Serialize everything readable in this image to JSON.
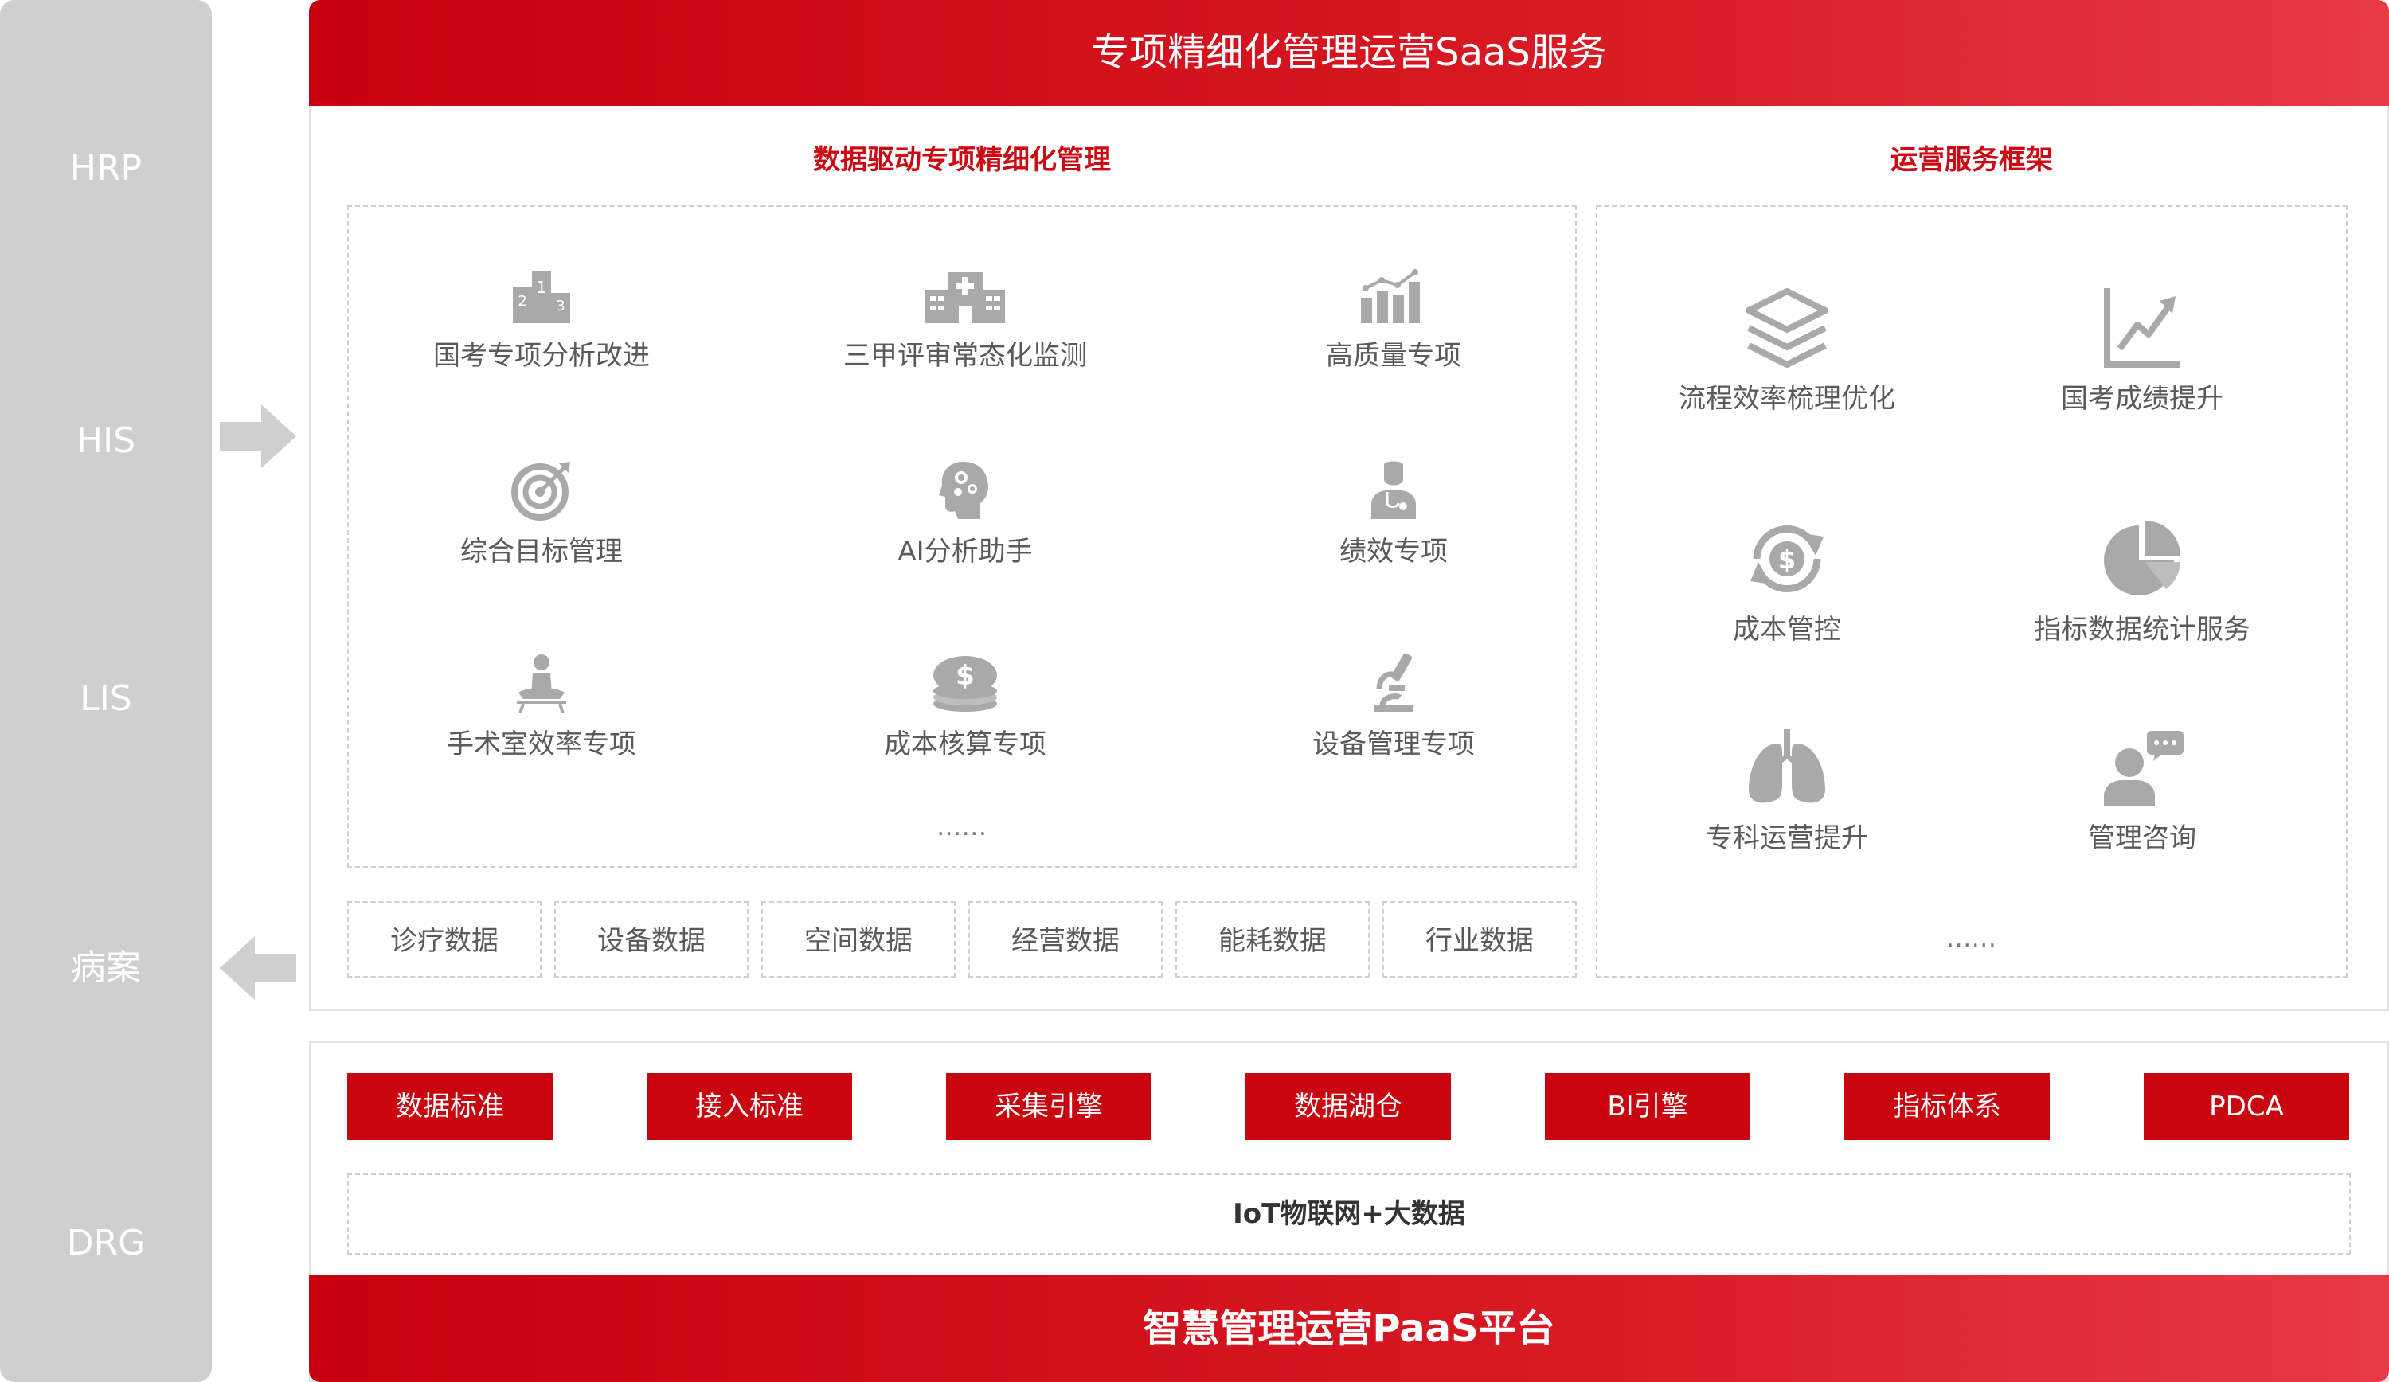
{
  "left_systems": [
    "HRP",
    "HIS",
    "LIS",
    "病案",
    "DRG"
  ],
  "saas": {
    "title": "专项精细化管理运营SaaS服务",
    "left_section": {
      "title": "数据驱动专项精细化管理",
      "features": [
        {
          "icon": "podium-icon",
          "label": "国考专项分析改进"
        },
        {
          "icon": "hospital-icon",
          "label": "三甲评审常态化监测"
        },
        {
          "icon": "bar-chart-icon",
          "label": "高质量专项"
        },
        {
          "icon": "target-icon",
          "label": "综合目标管理"
        },
        {
          "icon": "ai-head-icon",
          "label": "AI分析助手"
        },
        {
          "icon": "doctor-icon",
          "label": "绩效专项"
        },
        {
          "icon": "surgeon-icon",
          "label": "手术室效率专项"
        },
        {
          "icon": "coin-stack-icon",
          "label": "成本核算专项"
        },
        {
          "icon": "microscope-icon",
          "label": "设备管理专项"
        }
      ],
      "ellipsis": "......",
      "data_sources": [
        "诊疗数据",
        "设备数据",
        "空间数据",
        "经营数据",
        "能耗数据",
        "行业数据"
      ]
    },
    "right_section": {
      "title": "运营服务框架",
      "features": [
        {
          "icon": "layers-icon",
          "label": "流程效率梳理优化"
        },
        {
          "icon": "trend-chart-icon",
          "label": "国考成绩提升"
        },
        {
          "icon": "dollar-cycle-icon",
          "label": "成本管控"
        },
        {
          "icon": "pie-chart-icon",
          "label": "指标数据统计服务"
        },
        {
          "icon": "lungs-icon",
          "label": "专科运营提升"
        },
        {
          "icon": "consultant-icon",
          "label": "管理咨询"
        }
      ],
      "ellipsis": "......"
    }
  },
  "paas": {
    "modules": [
      "数据标准",
      "接入标准",
      "采集引擎",
      "数据湖仓",
      "BI引擎",
      "指标体系",
      "PDCA"
    ],
    "foundation": "IoT物联网+大数据",
    "title": "智慧管理运营PaaS平台"
  },
  "colors": {
    "accent": "#c9060f",
    "gray_panel": "#cfcfcf",
    "icon_gray": "#a9a9a9"
  }
}
